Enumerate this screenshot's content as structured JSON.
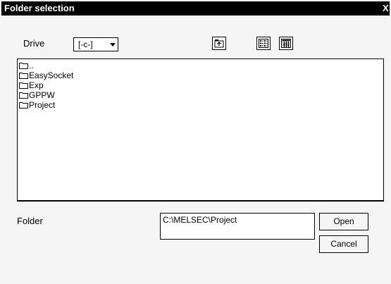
{
  "window": {
    "title": "Folder selection",
    "close_label": "X"
  },
  "drive": {
    "label": "Drive",
    "value": "[-c-]"
  },
  "toolbar": {
    "up_icon": "up-folder-icon",
    "list_icon": "list-view-icon",
    "details_icon": "details-view-icon"
  },
  "folder_list": {
    "items": [
      {
        "name": ".."
      },
      {
        "name": "EasySocket"
      },
      {
        "name": "Exp"
      },
      {
        "name": "GPPW"
      },
      {
        "name": "Project"
      }
    ]
  },
  "folder": {
    "label": "Folder",
    "path": "C:\\MELSEC\\Project"
  },
  "buttons": {
    "open": "Open",
    "cancel": "Cancel"
  }
}
